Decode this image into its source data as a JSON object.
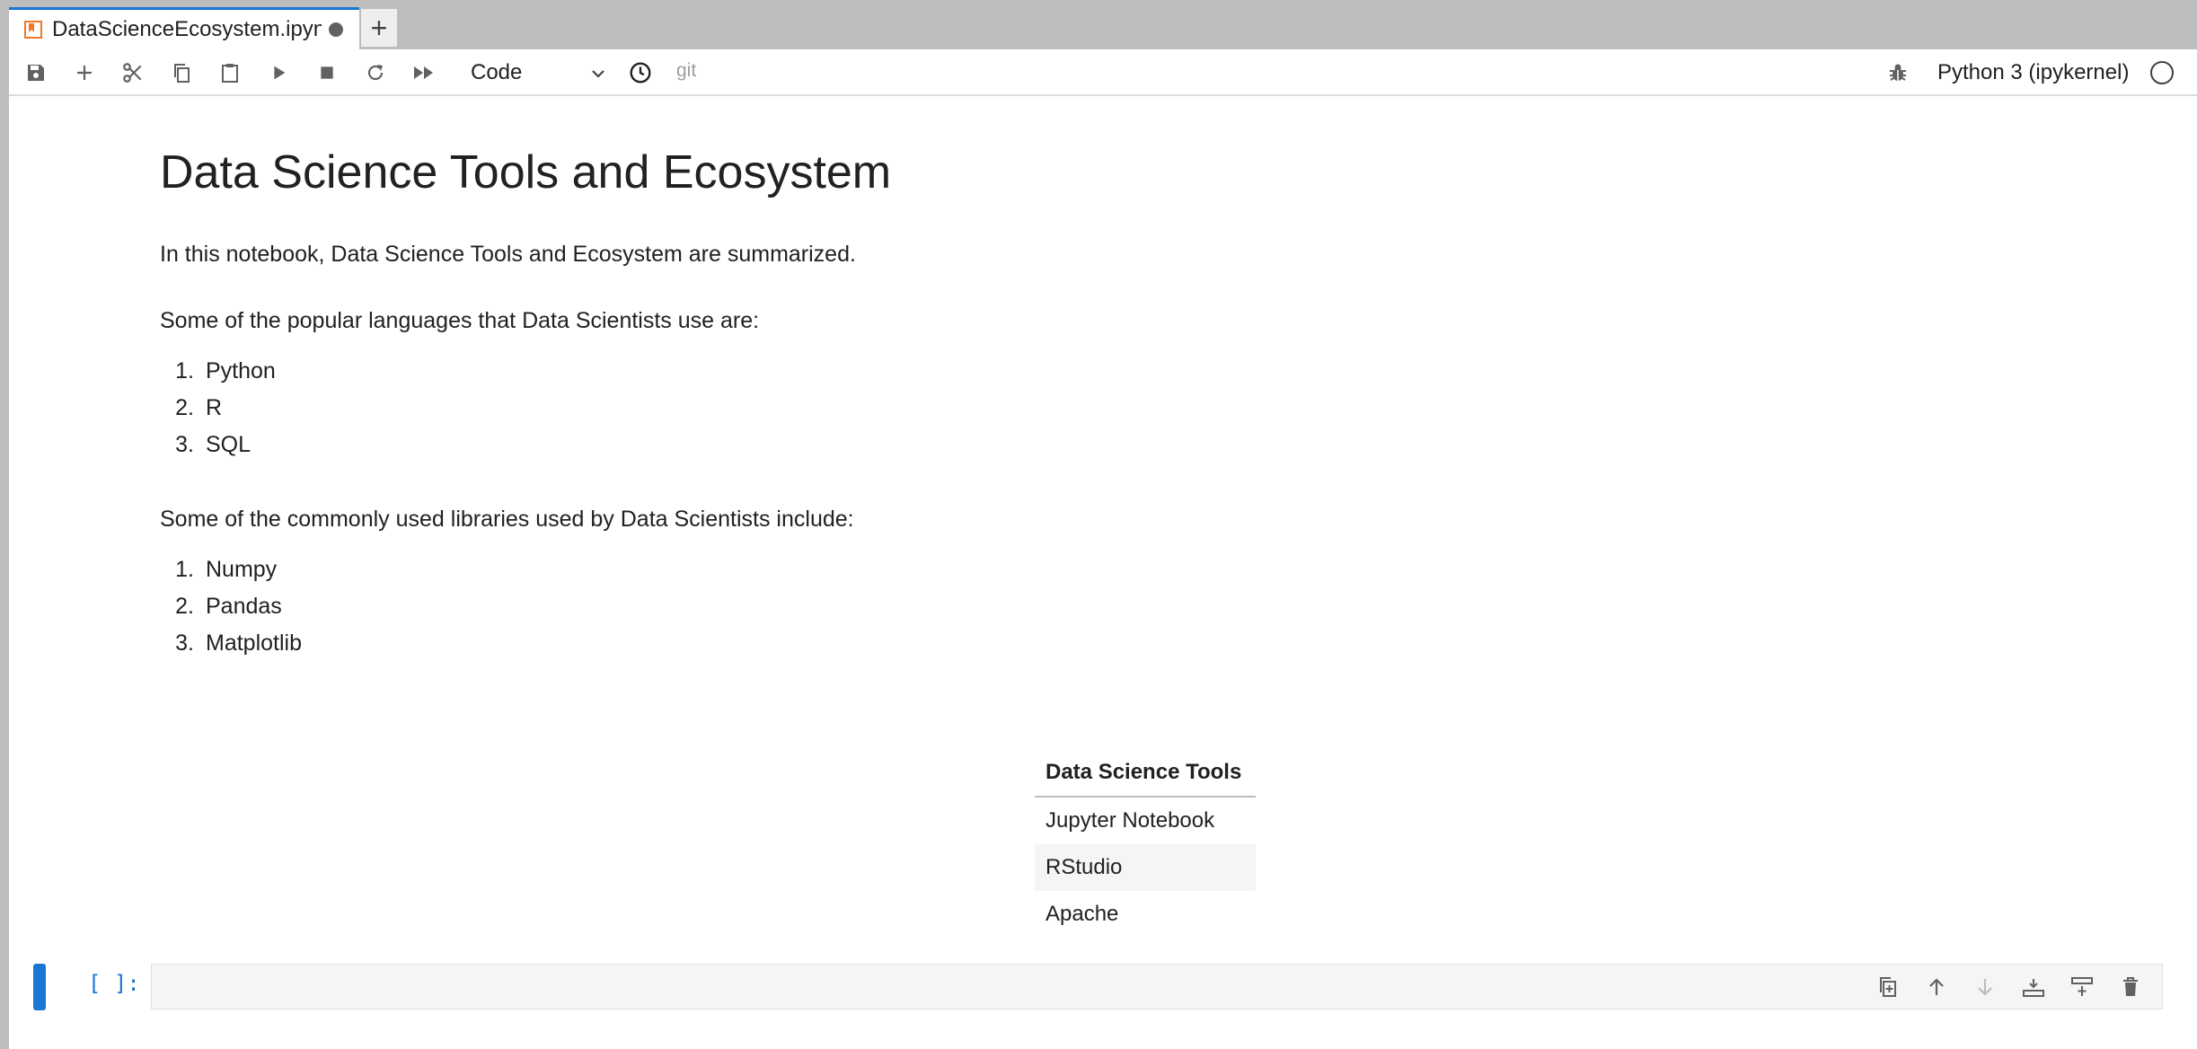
{
  "tab": {
    "title": "DataScienceEcosystem.ipynb",
    "new_tab_label": "+"
  },
  "toolbar": {
    "cell_type": "Code",
    "git_label": "git",
    "kernel_name": "Python 3 (ipykernel)"
  },
  "notebook": {
    "heading": "Data Science Tools and Ecosystem",
    "intro": "In this notebook, Data Science Tools and Ecosystem are summarized.",
    "languages_intro": "Some of the popular languages that Data Scientists use are:",
    "languages": [
      {
        "num": "1.",
        "name": "Python"
      },
      {
        "num": "2.",
        "name": "R"
      },
      {
        "num": "3.",
        "name": "SQL"
      }
    ],
    "libraries_intro": "Some of the commonly used libraries used by Data Scientists include:",
    "libraries": [
      {
        "num": "1.",
        "name": "Numpy"
      },
      {
        "num": "2.",
        "name": "Pandas"
      },
      {
        "num": "3.",
        "name": "Matplotlib"
      }
    ],
    "tools_table": {
      "header": "Data Science Tools",
      "rows": [
        "Jupyter Notebook",
        "RStudio",
        "Apache"
      ]
    },
    "code_cell": {
      "prompt": "[ ]:",
      "source": ""
    }
  },
  "colors": {
    "accent": "#1976d2",
    "notebook_icon": "#f37726",
    "panel_bg": "#ffffff",
    "chrome_bg": "#bdbdbd",
    "code_bg": "#f5f5f5"
  },
  "icons": {
    "tab": "notebook-icon",
    "toolbar": [
      "save-icon",
      "add-cell-icon",
      "cut-icon",
      "copy-icon",
      "paste-icon",
      "run-icon",
      "stop-icon",
      "restart-icon",
      "fast-forward-icon",
      "chevron-down-icon",
      "clock-icon",
      "bug-icon",
      "kernel-idle-icon"
    ],
    "cell": [
      "duplicate-icon",
      "arrow-up-icon",
      "arrow-down-icon",
      "insert-above-icon",
      "insert-below-icon",
      "trash-icon"
    ]
  }
}
